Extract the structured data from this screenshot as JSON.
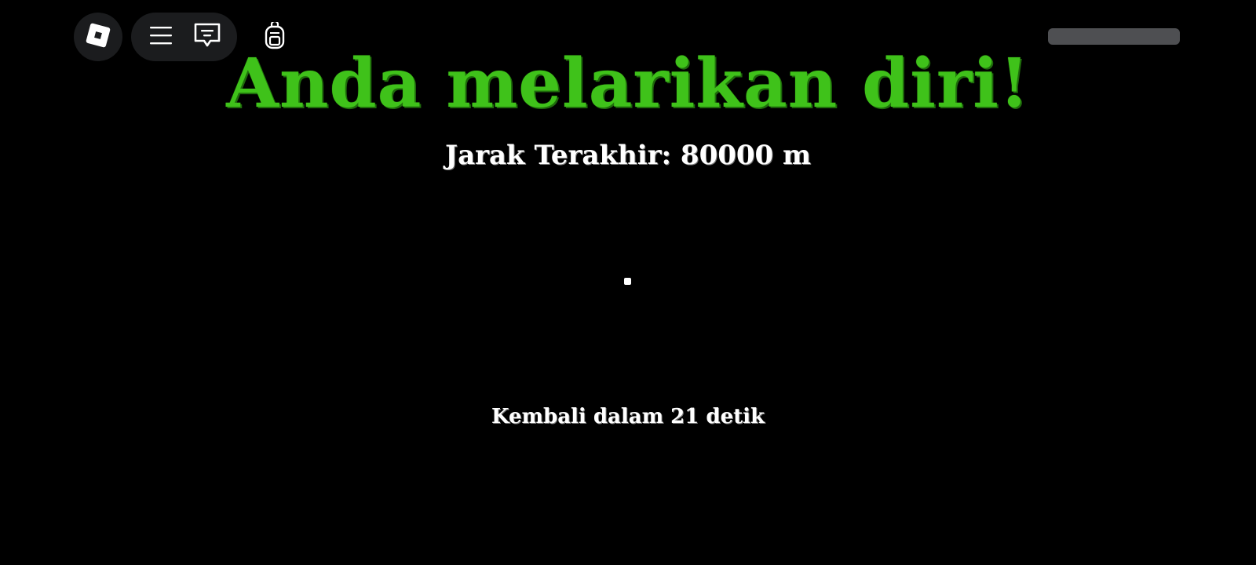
{
  "hud": {
    "logo_icon": "roblox-logo-icon",
    "menu_icon": "hamburger-menu-icon",
    "chat_icon": "chat-bubble-icon",
    "backpack_icon": "backpack-icon"
  },
  "main": {
    "title": "Anda melarikan diri!",
    "distance": "Jarak Terakhir: 80000 m",
    "countdown": "Kembali dalam 21 detik"
  },
  "colors": {
    "background": "#000000",
    "title": "#3fc21a",
    "text": "#ffffff",
    "hud_button": "#1b1c1e",
    "topbar_slot": "#4e4f52"
  }
}
